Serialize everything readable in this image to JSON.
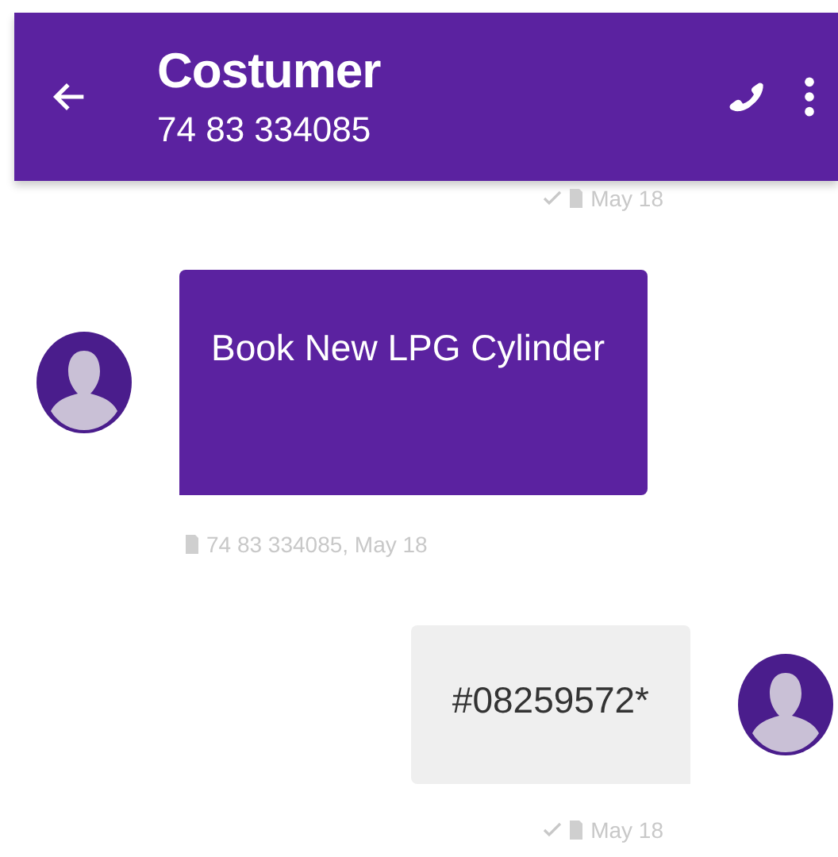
{
  "header": {
    "title": "Costumer",
    "subtitle": "74 83 334085"
  },
  "thread": [
    {
      "kind": "status",
      "sent": true,
      "info": "May 18"
    },
    {
      "kind": "incoming",
      "text": "Book New LPG Cylinder",
      "sent": false,
      "info": "74 83 334085, May 18"
    },
    {
      "kind": "outgoing",
      "text": "#08259572*",
      "sent": true,
      "info": "May 18"
    }
  ]
}
